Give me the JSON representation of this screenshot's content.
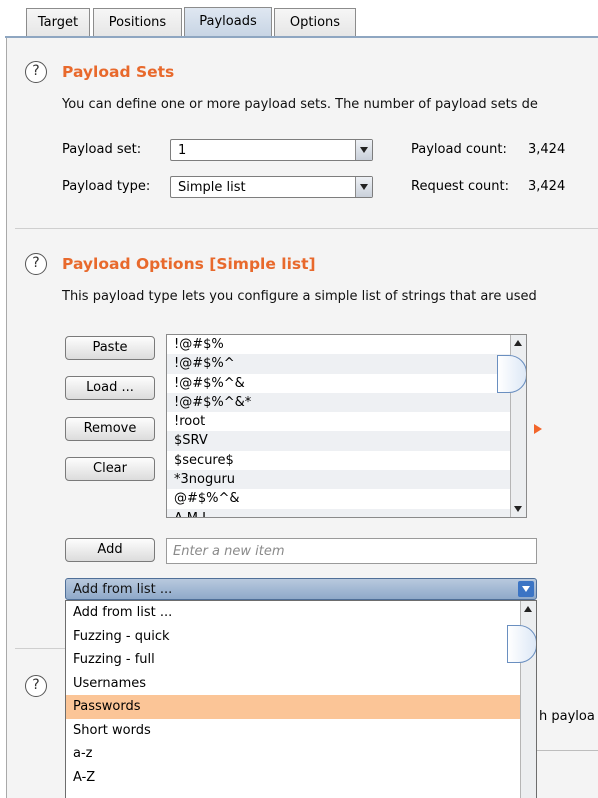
{
  "tabs": [
    {
      "label": "Target"
    },
    {
      "label": "Positions"
    },
    {
      "label": "Payloads"
    },
    {
      "label": "Options"
    }
  ],
  "active_tab": "Payloads",
  "payload_sets": {
    "title": "Payload Sets",
    "description": "You can define one or more payload sets. The number of payload sets de",
    "set_label": "Payload set:",
    "set_value": "1",
    "type_label": "Payload type:",
    "type_value": "Simple list",
    "payload_count_label": "Payload count:",
    "payload_count": "3,424",
    "request_count_label": "Request count:",
    "request_count": "3,424"
  },
  "payload_options": {
    "title": "Payload Options [Simple list]",
    "description": "This payload type lets you configure a simple list of strings that are used",
    "buttons": {
      "paste": "Paste",
      "load": "Load ...",
      "remove": "Remove",
      "clear": "Clear",
      "add": "Add"
    },
    "items": [
      "!@#$%",
      "!@#$%^",
      "!@#$%^&",
      "!@#$%^&*",
      "!root",
      "$SRV",
      "$secure$",
      "*3noguru",
      "@#$%^&",
      "A.M.I"
    ],
    "new_item_placeholder": "Enter a new item",
    "add_from_list": {
      "selected": "Add from list ...",
      "options": [
        "Add from list ...",
        "Fuzzing - quick",
        "Fuzzing - full",
        "Usernames",
        "Passwords",
        "Short words",
        "a-z",
        "A-Z"
      ],
      "highlighted": "Passwords"
    }
  },
  "partial_text": {
    "help3": "?",
    "right_fragment": "h payloa"
  },
  "colors": {
    "accent_title": "#e8692c",
    "highlight": "#fbc597",
    "tab_active": "#c7d4e4"
  }
}
